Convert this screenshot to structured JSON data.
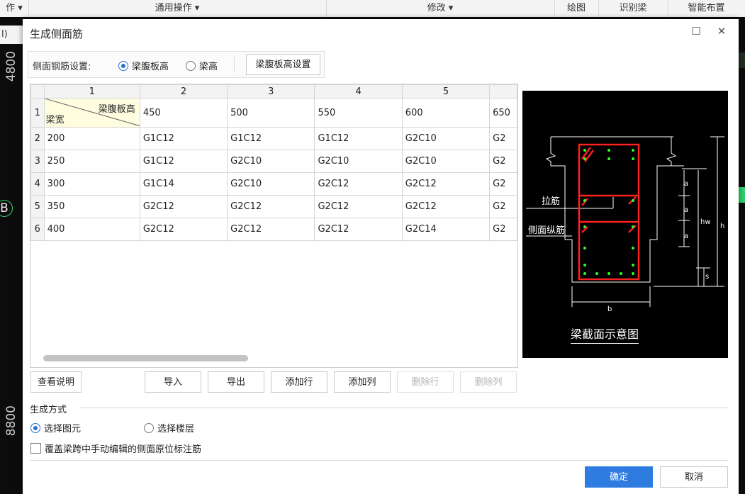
{
  "background": {
    "toolbar": [
      "作 ▾",
      "通用操作 ▾",
      "修改 ▾",
      "绘图",
      "识别梁",
      "智能布置"
    ],
    "left_tab": "l)",
    "canvas_labels": [
      "4800",
      "B",
      "8800"
    ]
  },
  "dialog": {
    "title": "生成侧面筋",
    "maximize_icon": "☐",
    "close_icon": "✕",
    "settings": {
      "label": "侧面钢筋设置:",
      "radio_web": "梁腹板高",
      "radio_beam": "梁高",
      "web_height_button": "梁腹板高设置"
    },
    "table": {
      "col_headers": [
        "1",
        "2",
        "3",
        "4",
        "5"
      ],
      "corner_top": "梁腹板高",
      "corner_bottom": "梁宽",
      "row_numbers": [
        "1",
        "2",
        "3",
        "4",
        "5",
        "6"
      ],
      "header_row": [
        "450",
        "500",
        "550",
        "600",
        "650"
      ],
      "rows": [
        {
          "width": "200",
          "cells": [
            "G1C12",
            "G1C12",
            "G1C12",
            "G2C10",
            "G2"
          ]
        },
        {
          "width": "250",
          "cells": [
            "G1C12",
            "G2C10",
            "G2C10",
            "G2C10",
            "G2"
          ]
        },
        {
          "width": "300",
          "cells": [
            "G1C14",
            "G2C10",
            "G2C12",
            "G2C12",
            "G2"
          ]
        },
        {
          "width": "350",
          "cells": [
            "G2C12",
            "G2C12",
            "G2C12",
            "G2C12",
            "G2"
          ]
        },
        {
          "width": "400",
          "cells": [
            "G2C12",
            "G2C12",
            "G2C12",
            "G2C14",
            "G2"
          ]
        }
      ]
    },
    "diagram": {
      "tie_bar": "拉筋",
      "side_bar": "侧面纵筋",
      "caption": "梁截面示意图",
      "a": "a",
      "hw": "hw",
      "h": "h",
      "b": "b",
      "s": "s"
    },
    "buttons": {
      "view_notes": "查看说明",
      "import": "导入",
      "export": "导出",
      "add_row": "添加行",
      "add_col": "添加列",
      "delete_row": "删除行",
      "delete_col": "删除列"
    },
    "generation": {
      "title": "生成方式",
      "select_element": "选择图元",
      "select_floor": "选择楼层",
      "override": "覆盖梁跨中手动编辑的侧面原位标注筋"
    },
    "footer": {
      "ok": "确定",
      "cancel": "取消"
    }
  }
}
